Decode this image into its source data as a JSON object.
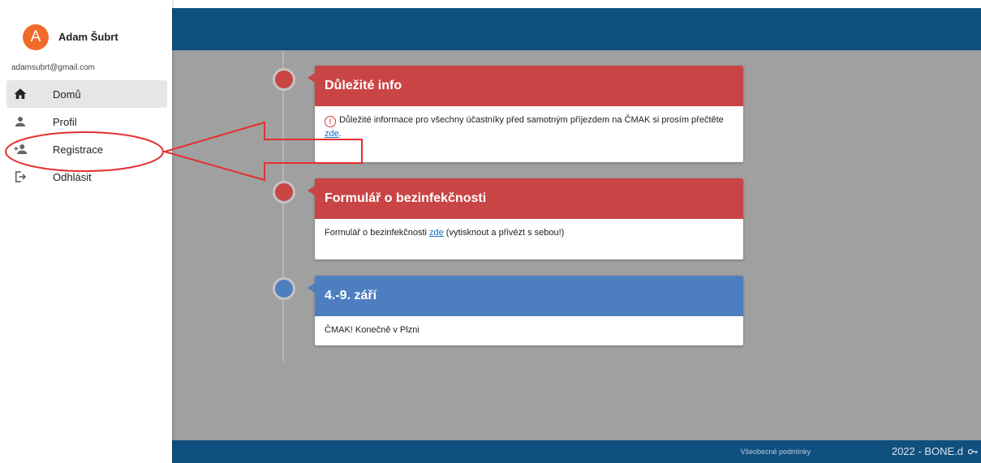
{
  "user": {
    "initial": "A",
    "name": "Adam Šubrt",
    "email": "adamsubrt@gmail.com"
  },
  "nav": [
    {
      "label": "Domů",
      "icon": "home-icon",
      "active": true
    },
    {
      "label": "Profil",
      "icon": "person-icon",
      "active": false
    },
    {
      "label": "Registrace",
      "icon": "person-add-icon",
      "active": false
    },
    {
      "label": "Odhlásit",
      "icon": "logout-icon",
      "active": false
    }
  ],
  "timeline": [
    {
      "title": "Důležité info",
      "color": "#c94545",
      "text_before": "Důležité informace pro všechny účastníky před samotným příjezdem na ČMAK si prosím přečtěte ",
      "link": "zde",
      "text_after": ".",
      "warning_icon": "warning-circle-icon"
    },
    {
      "title": "Formulář o bezinfekčnosti",
      "color": "#c94545",
      "text_before": "Formulář o bezinfekčnosti ",
      "link": "zde",
      "text_after": " (vytisknout a přivézt s sebou!)"
    },
    {
      "title": "4.-9. září",
      "color": "#4f7ec0",
      "text_before": "ČMAK! Konečně v Plzni",
      "link": "",
      "text_after": ""
    }
  ],
  "footer": {
    "terms": "Všeobecné podmínky",
    "copyright": "2022 - BONE.d"
  },
  "colors": {
    "header": "#10507e",
    "overlay": "#a0a0a0",
    "red": "#c94545",
    "blue": "#4f7ec0",
    "annotation": "#e53030"
  }
}
